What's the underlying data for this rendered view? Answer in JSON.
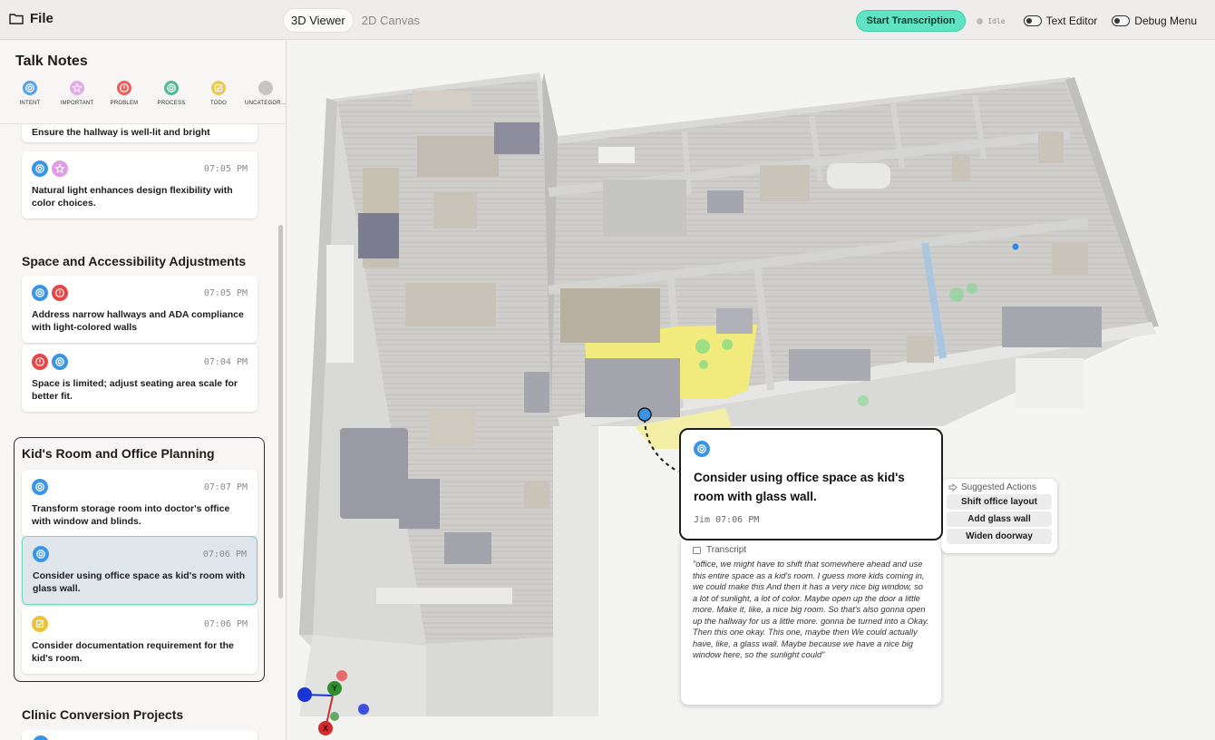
{
  "topbar": {
    "file_label": "File",
    "tabs": [
      {
        "label": "3D Viewer",
        "active": true
      },
      {
        "label": "2D Canvas",
        "active": false
      }
    ],
    "start_button": "Start Transcription",
    "status": "Idle",
    "toggles": [
      {
        "label": "Text Editor",
        "on": false
      },
      {
        "label": "Debug Menu",
        "on": false
      }
    ]
  },
  "sidebar": {
    "title": "Talk Notes",
    "categories": [
      {
        "label": "INTENT",
        "icon": "target-icon",
        "color": "#3b95e5"
      },
      {
        "label": "IMPORTANT",
        "icon": "star-icon",
        "color": "#e09de6"
      },
      {
        "label": "PROBLEM",
        "icon": "alert-icon",
        "color": "#e54646"
      },
      {
        "label": "PROCESS",
        "icon": "target-icon",
        "color": "#37b08a"
      },
      {
        "label": "TODO",
        "icon": "checklist-icon",
        "color": "#e9c238"
      },
      {
        "label": "UNCATEGOR…",
        "icon": "circle-icon",
        "color": "#bcbcbc"
      }
    ],
    "partial_note": "Ensure the hallway is well-lit and bright",
    "groups": [
      {
        "title": "",
        "notes": [
          {
            "time": "07:05 PM",
            "text": "Natural light enhances design flexibility with color choices.",
            "badges": [
              "intent",
              "important"
            ]
          }
        ]
      },
      {
        "title": "Space and Accessibility Adjustments",
        "notes": [
          {
            "time": "07:05 PM",
            "text": "Address narrow hallways and ADA compliance with light-colored walls",
            "badges": [
              "intent",
              "problem"
            ]
          },
          {
            "time": "07:04 PM",
            "text": "Space is limited; adjust seating area scale for better fit.",
            "badges": [
              "problem",
              "intent"
            ]
          }
        ]
      },
      {
        "title": "Kid's Room and Office Planning",
        "notes": [
          {
            "time": "07:07 PM",
            "text": "Transform storage room into doctor's office with window and blinds.",
            "badges": [
              "intent"
            ]
          },
          {
            "time": "07:06 PM",
            "text": "Consider using office space as kid's room with glass wall.",
            "badges": [
              "intent"
            ],
            "selected": true
          },
          {
            "time": "07:06 PM",
            "text": "Consider documentation requirement for the kid's room.",
            "badges": [
              "todo"
            ]
          }
        ]
      },
      {
        "title": "Clinic Conversion Projects",
        "notes": []
      }
    ]
  },
  "popup": {
    "text": "Consider using office space as kid's room with glass wall.",
    "meta": "Jim 07:06 PM"
  },
  "transcript": {
    "label": "Transcript",
    "text": "\"office, we might have to shift that somewhere ahead and use this entire space as a kid's room. I guess more kids coming in, we could make this And then it has a very nice big window, so a lot of sunlight, a lot of color. Maybe open up the door a little more. Make it, like, a nice big room. So that's also gonna open up the hallway for us a little more. gonna be turned into a Okay. Then this one okay. This one, maybe then We could actually have, like, a glass wall. Maybe because we have a nice big window here, so the sunlight could\""
  },
  "suggested_actions": {
    "title": "Suggested Actions",
    "items": [
      "Shift office layout",
      "Add glass wall",
      "Widen doorway"
    ]
  },
  "axes_gizmo": {
    "labels": [
      "Y",
      "X"
    ]
  },
  "colors": {
    "accent": "#5fe3c2",
    "intent": "#3b95e5",
    "selection_border": "#6fd8bf",
    "highlight_floor": "#f1ea7c"
  }
}
